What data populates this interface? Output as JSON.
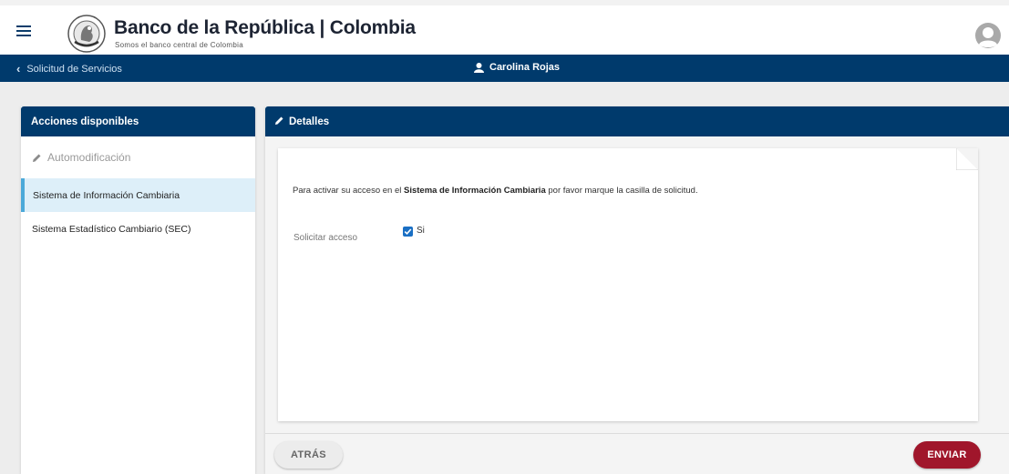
{
  "header": {
    "title": "Banco de la República | Colombia",
    "subtitle": "Somos el banco central de Colombia",
    "menu_icon": "hamburger-icon",
    "logo_icon": "bank-seal-logo",
    "avatar_icon": "user-avatar-icon"
  },
  "navbar": {
    "back_label": "Solicitud de Servicios",
    "user_name": "Carolina Rojas"
  },
  "sidebar": {
    "title": "Acciones disponibles",
    "items": [
      {
        "label": "Automodificación",
        "state": "disabled"
      },
      {
        "label": "Sistema de Información Cambiaria",
        "state": "active"
      },
      {
        "label": "Sistema Estadístico Cambiario (SEC)",
        "state": "normal"
      }
    ]
  },
  "details": {
    "title": "Detalles",
    "instruction_pre": "Para activar su acceso en el ",
    "instruction_bold": "Sistema de Información Cambiaria",
    "instruction_post": " por favor marque la casilla de solicitud.",
    "field_label": "Solicitar acceso",
    "checkbox_label": "Si",
    "checkbox_checked": true
  },
  "actions": {
    "back_label": "ATRÁS",
    "send_label": "ENVIAR"
  },
  "colors": {
    "primary": "#003a6c",
    "accent": "#a0162b",
    "active_bg": "#ddeff9",
    "checkbox": "#1a6fc4"
  }
}
